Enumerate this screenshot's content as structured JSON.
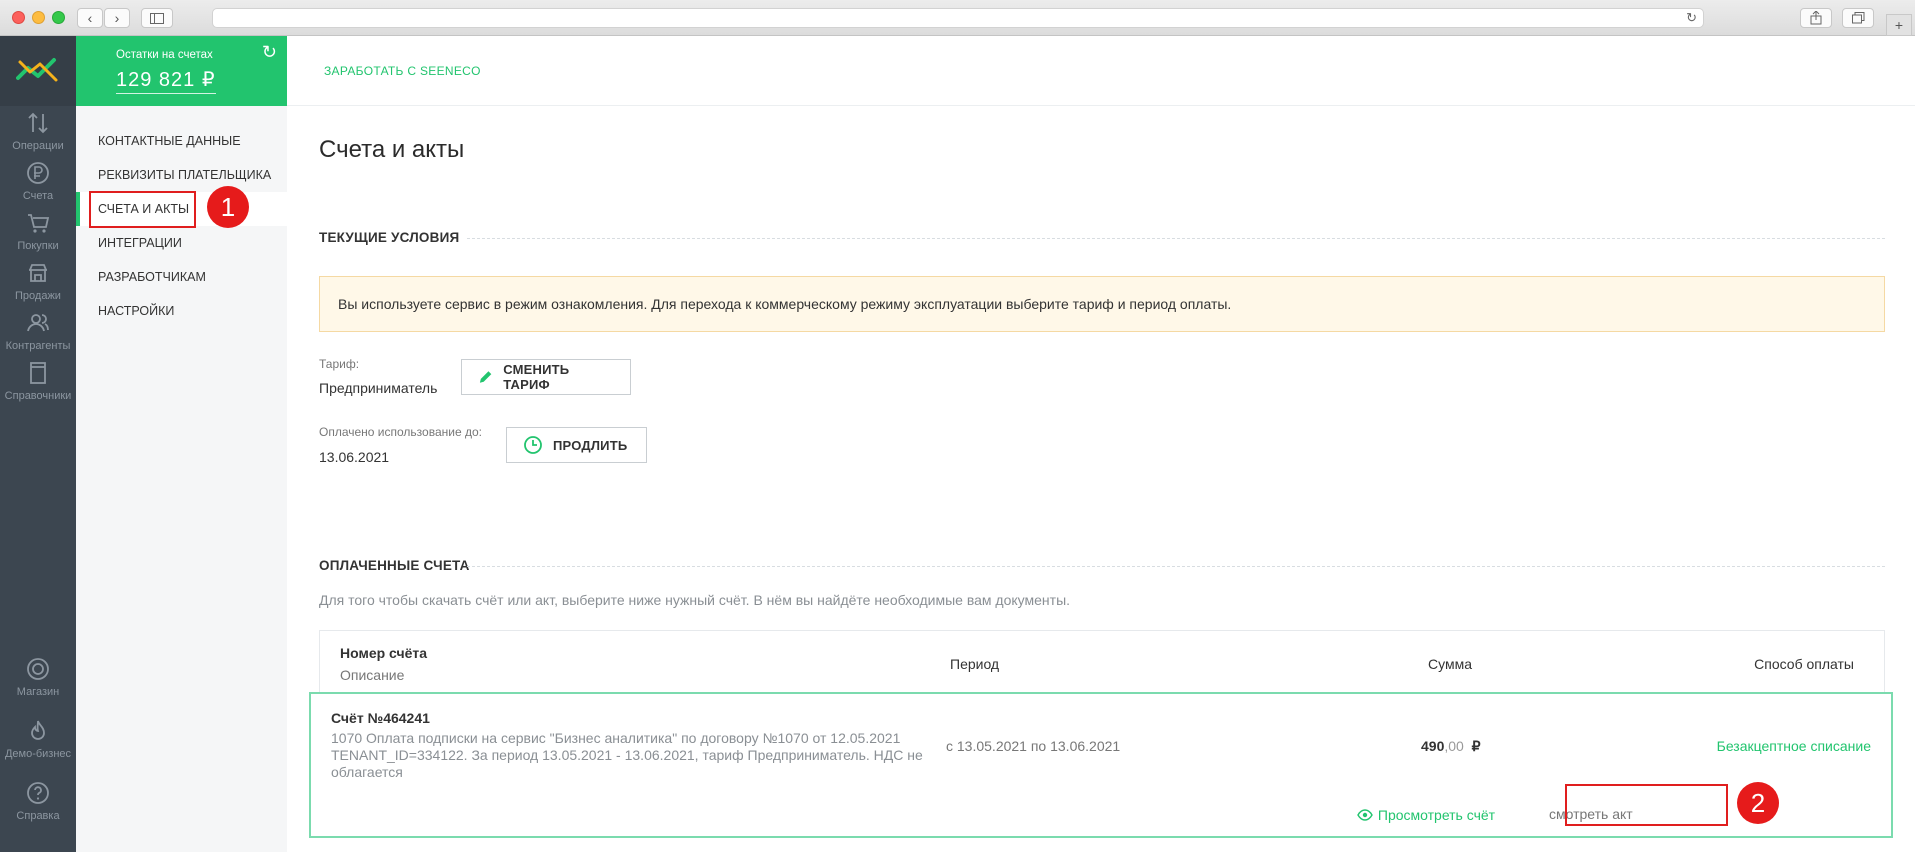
{
  "colors": {
    "accent_green": "#22c46e",
    "rail_dark": "#3c4650",
    "marker_red": "#e61b1b",
    "notice_bg": "#fff8e8"
  },
  "browser": {
    "back_icon": "chevron-left-icon",
    "forward_icon": "chevron-right-icon",
    "sidebar_icon": "sidebar-toggle-icon",
    "reload_icon": "reload-icon",
    "share_icon": "share-icon",
    "tabs_icon": "tabs-icon",
    "new_tab_icon": "plus-icon"
  },
  "rail": {
    "items": [
      {
        "label": "Операции",
        "icon": "arrows-up-down-icon"
      },
      {
        "label": "Счета",
        "icon": "ruble-circle-icon"
      },
      {
        "label": "Покупки",
        "icon": "cart-icon"
      },
      {
        "label": "Продажи",
        "icon": "shop-icon"
      },
      {
        "label": "Контрагенты",
        "icon": "contacts-icon"
      },
      {
        "label": "Справочники",
        "icon": "book-icon"
      }
    ],
    "bottom_items": [
      {
        "label": "Магазин",
        "icon": "store-icon"
      },
      {
        "label": "Демо-бизнес",
        "icon": "flame-icon"
      },
      {
        "label": "Справка",
        "icon": "help-icon"
      }
    ]
  },
  "balance": {
    "label": "Остатки на счетах",
    "value": "129 821 ₽"
  },
  "submenu": {
    "items": [
      {
        "label": "КОНТАКТНЫЕ ДАННЫЕ"
      },
      {
        "label": "РЕКВИЗИТЫ ПЛАТЕЛЬЩИКА"
      },
      {
        "label": "СЧЕТА И АКТЫ"
      },
      {
        "label": "ИНТЕГРАЦИИ"
      },
      {
        "label": "РАЗРАБОТЧИКАМ"
      },
      {
        "label": "НАСТРОЙКИ"
      }
    ],
    "active_index": 2
  },
  "markers": [
    "1",
    "2"
  ],
  "topbar": {
    "link": "ЗАРАБОТАТЬ С SEENECO"
  },
  "main": {
    "title": "Счета и акты",
    "current_terms": {
      "heading": "ТЕКУЩИЕ УСЛОВИЯ",
      "notice": "Вы используете сервис в режим ознакомления. Для перехода к коммерческому режиму эксплуатации выберите тариф и период оплаты.",
      "tariff_label": "Тариф:",
      "tariff_value": "Предприниматель",
      "change_tariff_button": "СМЕНИТЬ ТАРИФ",
      "paid_until_label": "Оплачено использование до:",
      "paid_until_value": "13.06.2021",
      "extend_button": "ПРОДЛИТЬ"
    },
    "paid_invoices": {
      "heading": "ОПЛАЧЕННЫЕ СЧЕТА",
      "hint": "Для того чтобы скачать счёт или акт, выберите ниже нужный счёт. В нём вы найдёте необходимые вам документы.",
      "columns": {
        "number": "Номер счёта",
        "description": "Описание",
        "period": "Период",
        "sum": "Сумма",
        "payment_method": "Способ оплаты"
      },
      "rows": [
        {
          "number": "Счёт №464241",
          "description": "1070 Оплата подписки на сервис \"Бизнес аналитика\" по договору №1070 от 12.05.2021 TENANT_ID=334122. За период 13.05.2021 - 13.06.2021, тариф Предприниматель. НДС не облагается",
          "period": "с 13.05.2021 по 13.06.2021",
          "sum_main": "490",
          "sum_kop": ",00",
          "currency": "₽",
          "payment_method": "Безакцептное списание",
          "view_invoice": "Просмотреть счёт",
          "view_act": "смотреть акт"
        }
      ]
    }
  }
}
